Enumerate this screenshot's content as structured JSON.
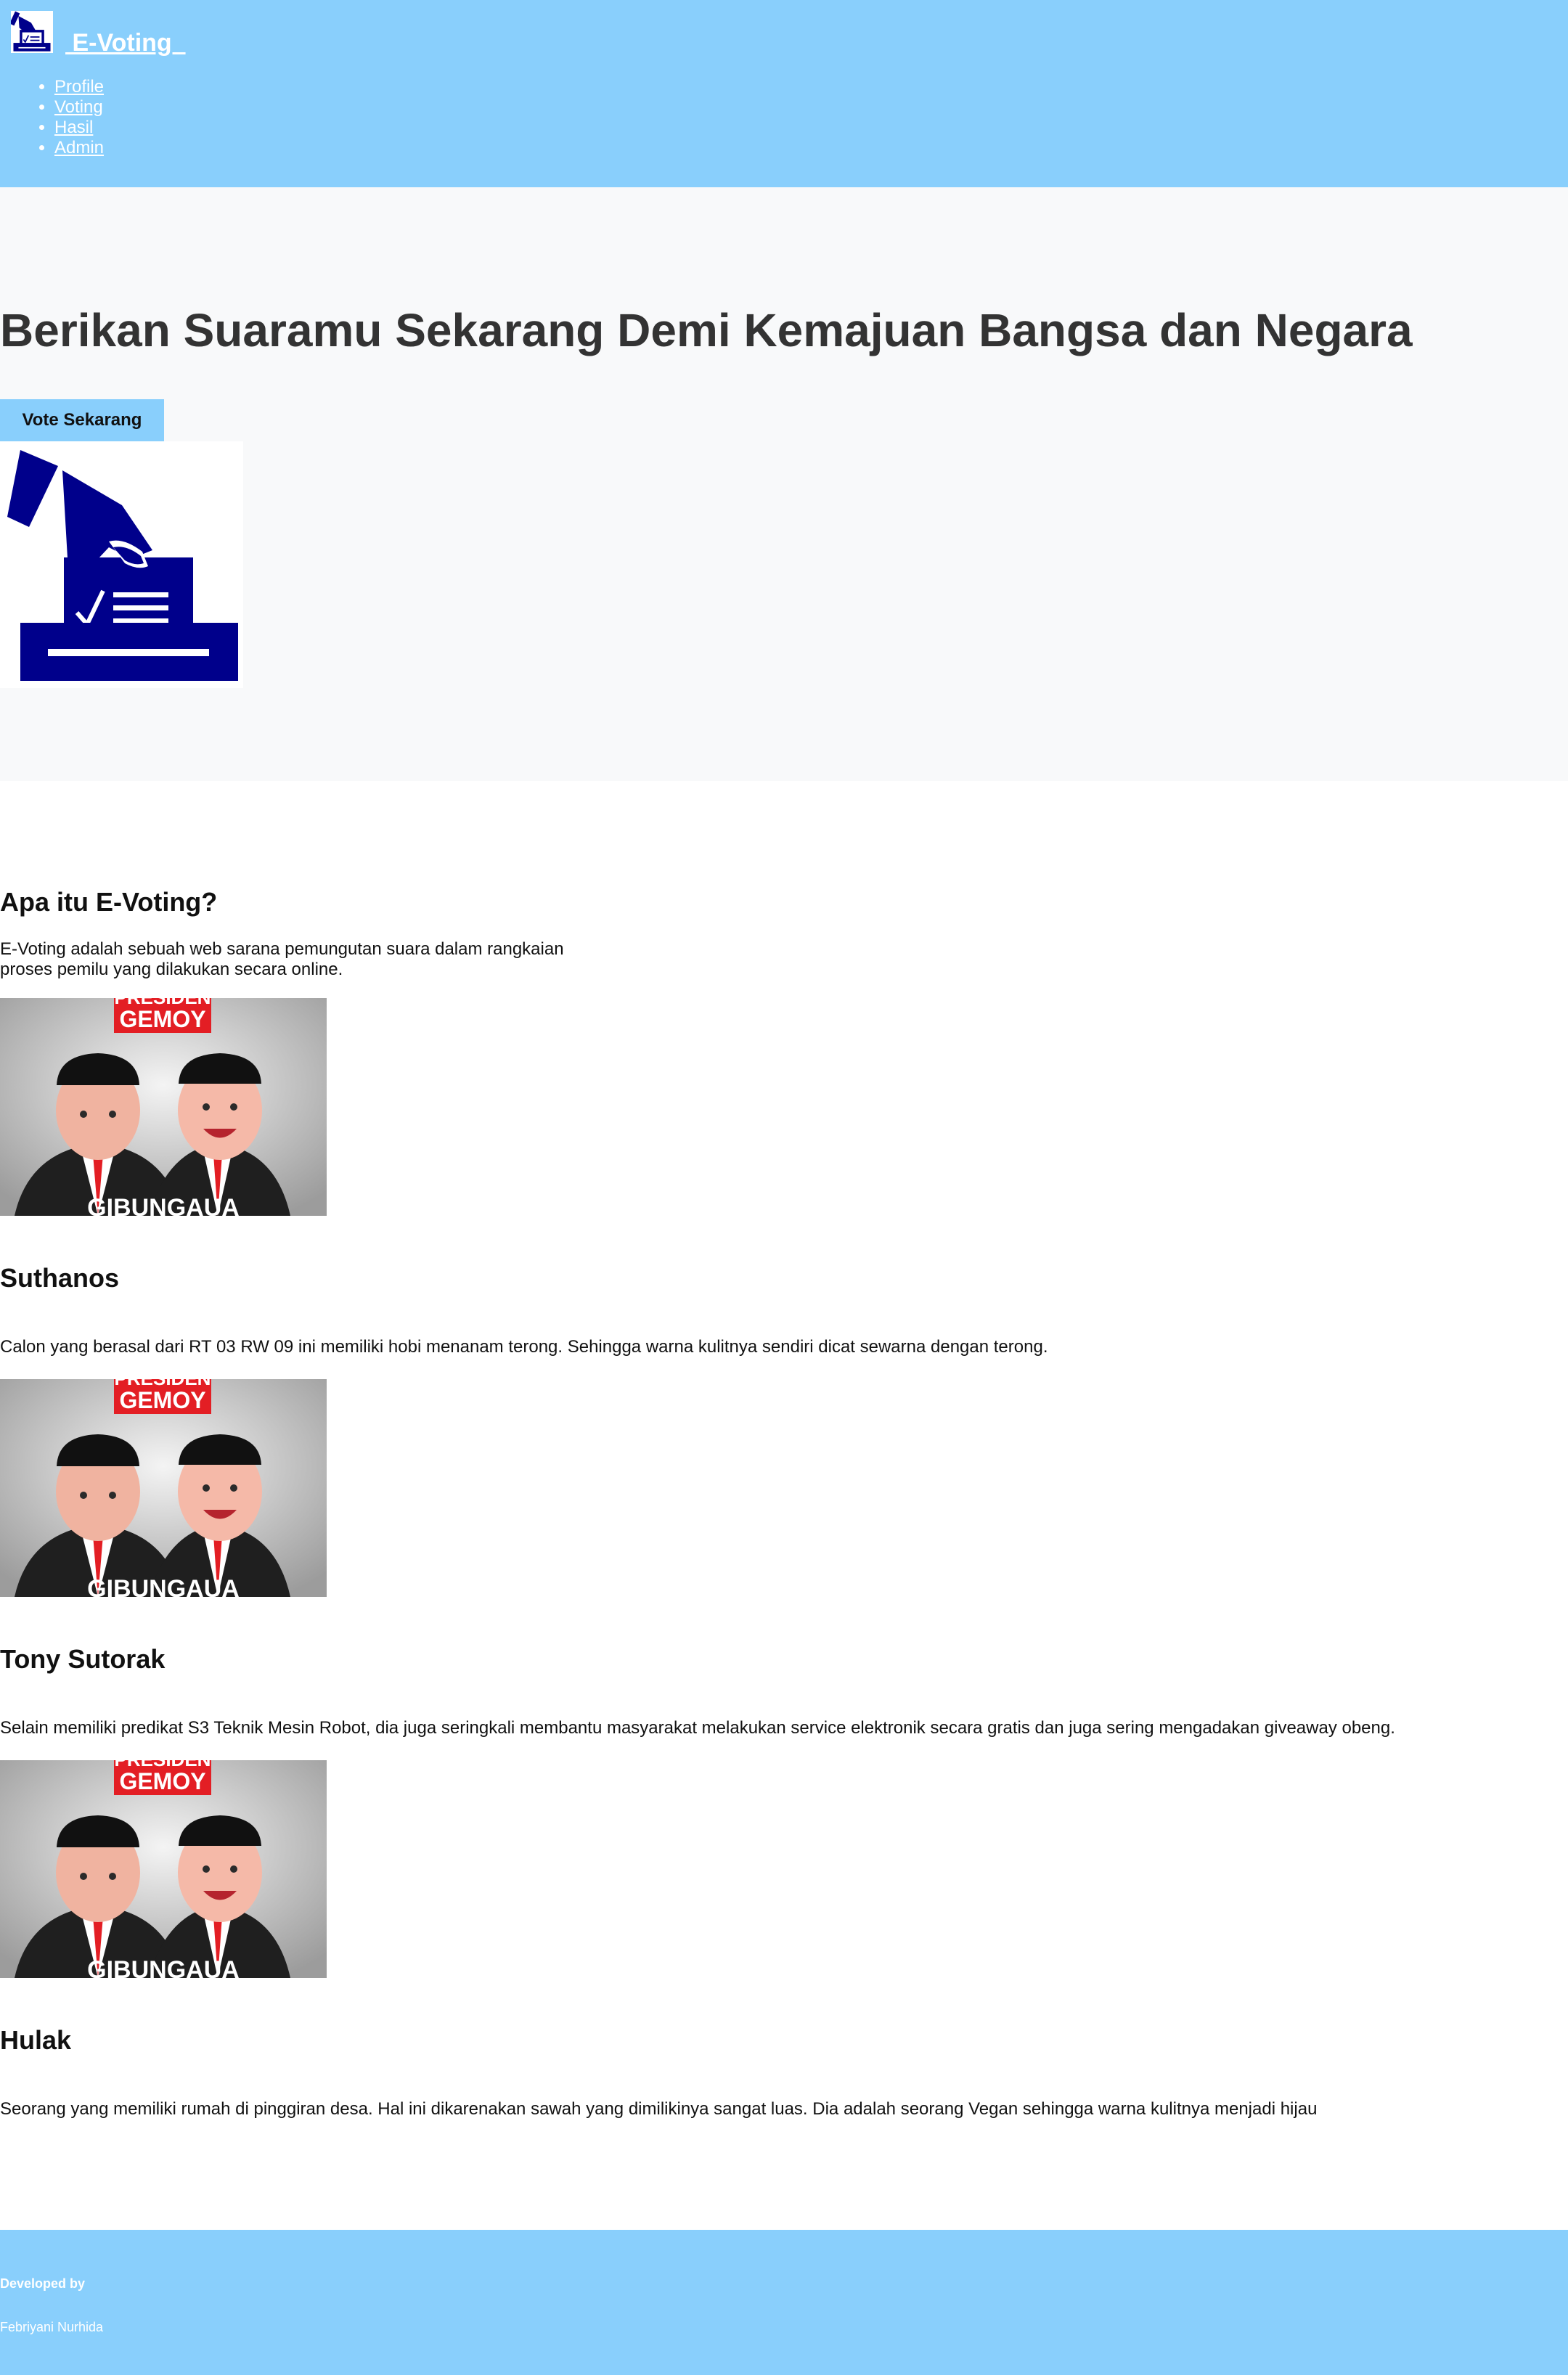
{
  "header": {
    "brand": " E-Voting  ",
    "nav": [
      "Profile",
      "Voting",
      "Hasil",
      "Admin"
    ]
  },
  "hero": {
    "title": "Berikan Suaramu Sekarang Demi Kemajuan Bangsa dan Negara",
    "button_label": "Vote Sekarang"
  },
  "about": {
    "title": "Apa itu E-Voting?",
    "text": "E-Voting adalah sebuah web sarana pemungutan suara dalam rangkaian proses pemilu yang dilakukan secara online."
  },
  "poster": {
    "top_text": "PRESIDEN",
    "bottom_text": "GEMOY",
    "footer_text": "GIBUNGAUA"
  },
  "candidates": [
    {
      "name": "Suthanos",
      "description": "Calon yang berasal dari RT 03 RW 09 ini memiliki hobi menanam terong. Sehingga warna kulitnya sendiri dicat sewarna dengan terong."
    },
    {
      "name": "Tony Sutorak",
      "description": "Selain memiliki predikat S3 Teknik Mesin Robot, dia juga seringkali membantu masyarakat melakukan service elektronik secara gratis dan juga sering mengadakan giveaway obeng."
    },
    {
      "name": "Hulak",
      "description": "Seorang yang memiliki rumah di pinggiran desa. Hal ini dikarenakan sawah yang dimilikinya sangat luas. Dia adalah seorang Vegan sehingga warna kulitnya menjadi hijau"
    }
  ],
  "footer": {
    "developed_by": "Developed by",
    "developer": "Febriyani Nurhida"
  },
  "colors": {
    "header_bg": "#89cffc",
    "hero_bg": "#f8f9fa",
    "icon_navy": "#00008b",
    "poster_red": "#e31e24"
  },
  "icons": {
    "logo": "ballot-box-icon",
    "hero": "ballot-box-icon"
  }
}
